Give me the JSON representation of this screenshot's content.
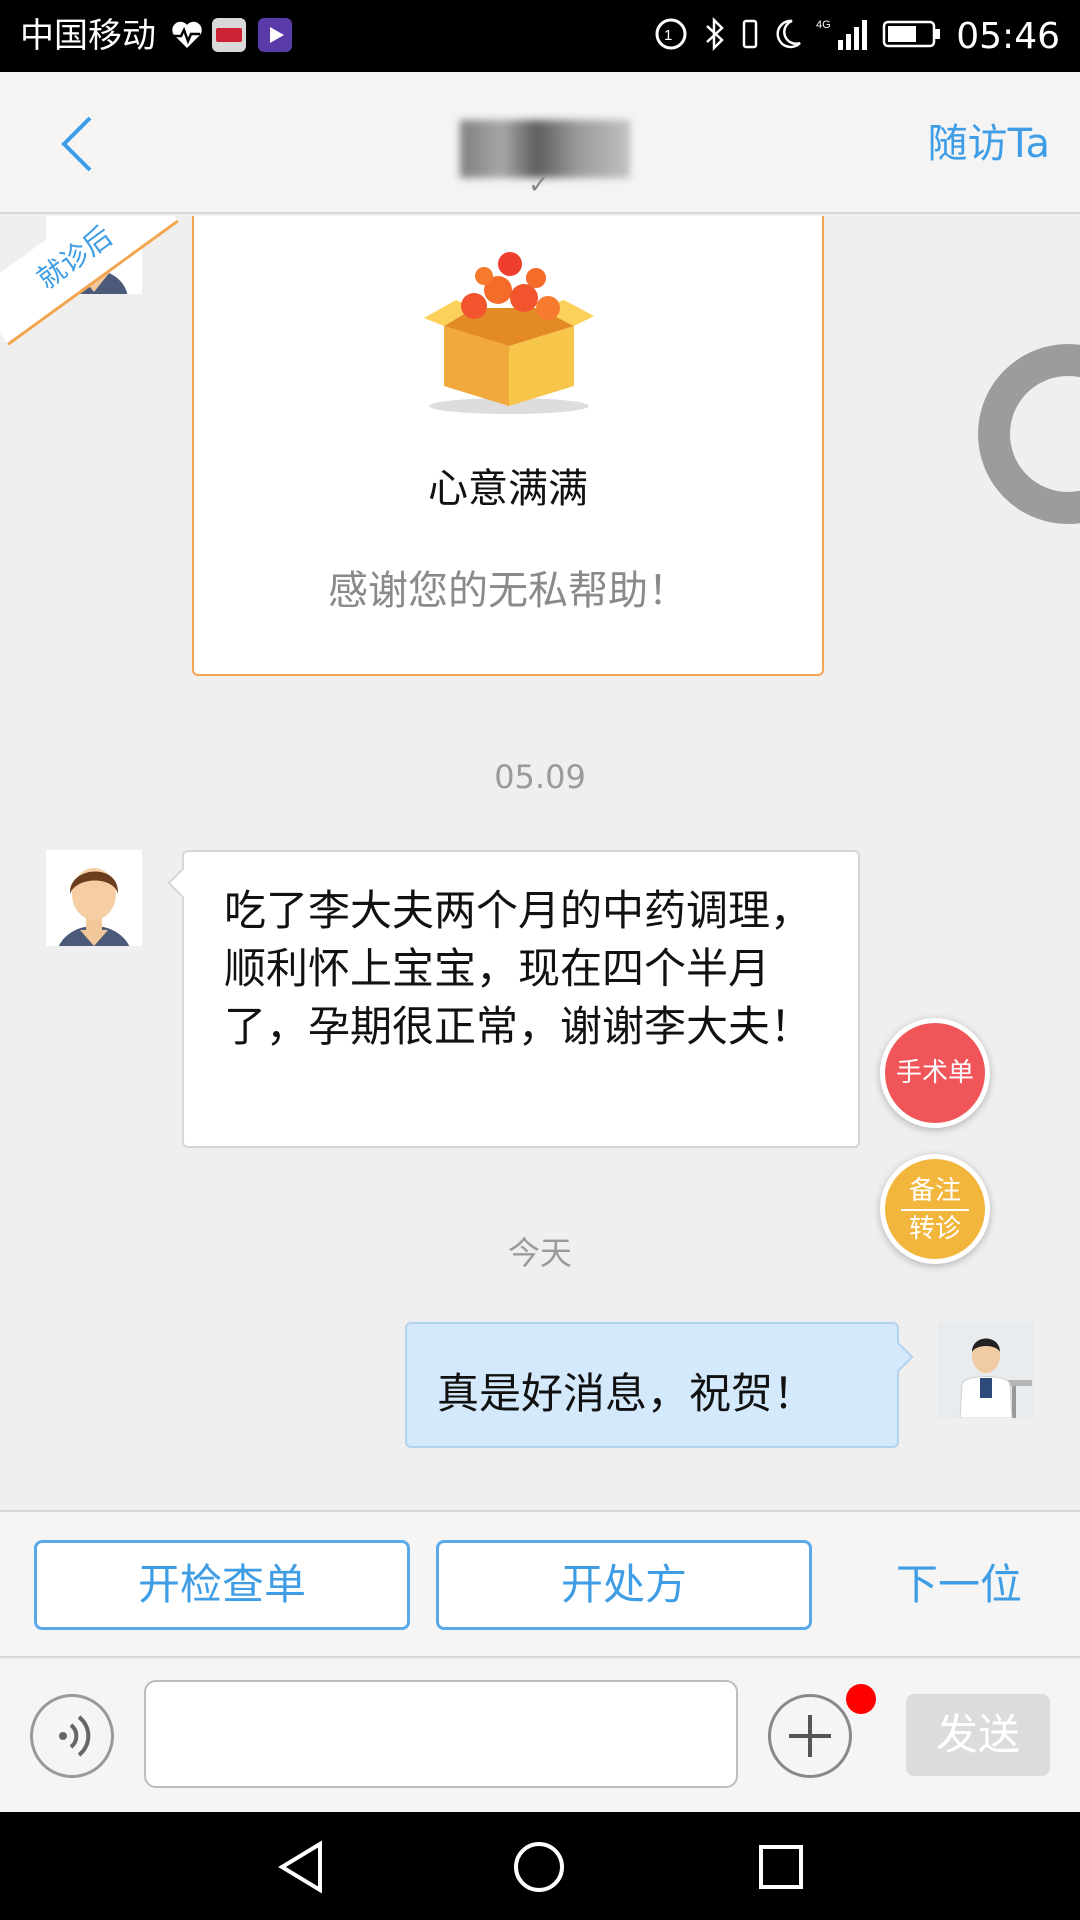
{
  "status_bar": {
    "carrier": "中国移动",
    "time": "05:46",
    "network": "4G"
  },
  "header": {
    "follow_up": "随访Ta"
  },
  "chat": {
    "ribbon": "就诊后",
    "gift_card": {
      "title": "心意满满",
      "message": "感谢您的无私帮助！"
    },
    "date_1": "05.09",
    "patient_message": "吃了李大夫两个月的中药调理，顺利怀上宝宝，现在四个半月了，孕期很正常，谢谢李大夫！",
    "date_2": "今天",
    "doctor_message": "真是好消息，祝贺！"
  },
  "floating_buttons": {
    "surgery_form": "手术单",
    "note_line1": "备注",
    "note_line2": "转诊"
  },
  "actions": {
    "exam_order": "开检查单",
    "prescription": "开处方",
    "next_patient": "下一位"
  },
  "input_bar": {
    "text_value": "",
    "send": "发送"
  },
  "colors": {
    "accent": "#3f9de5",
    "gift_border": "#f2a650",
    "doctor_bubble": "#d4eafc",
    "surgery_fab": "#f0555a",
    "note_fab": "#f2b63c"
  }
}
